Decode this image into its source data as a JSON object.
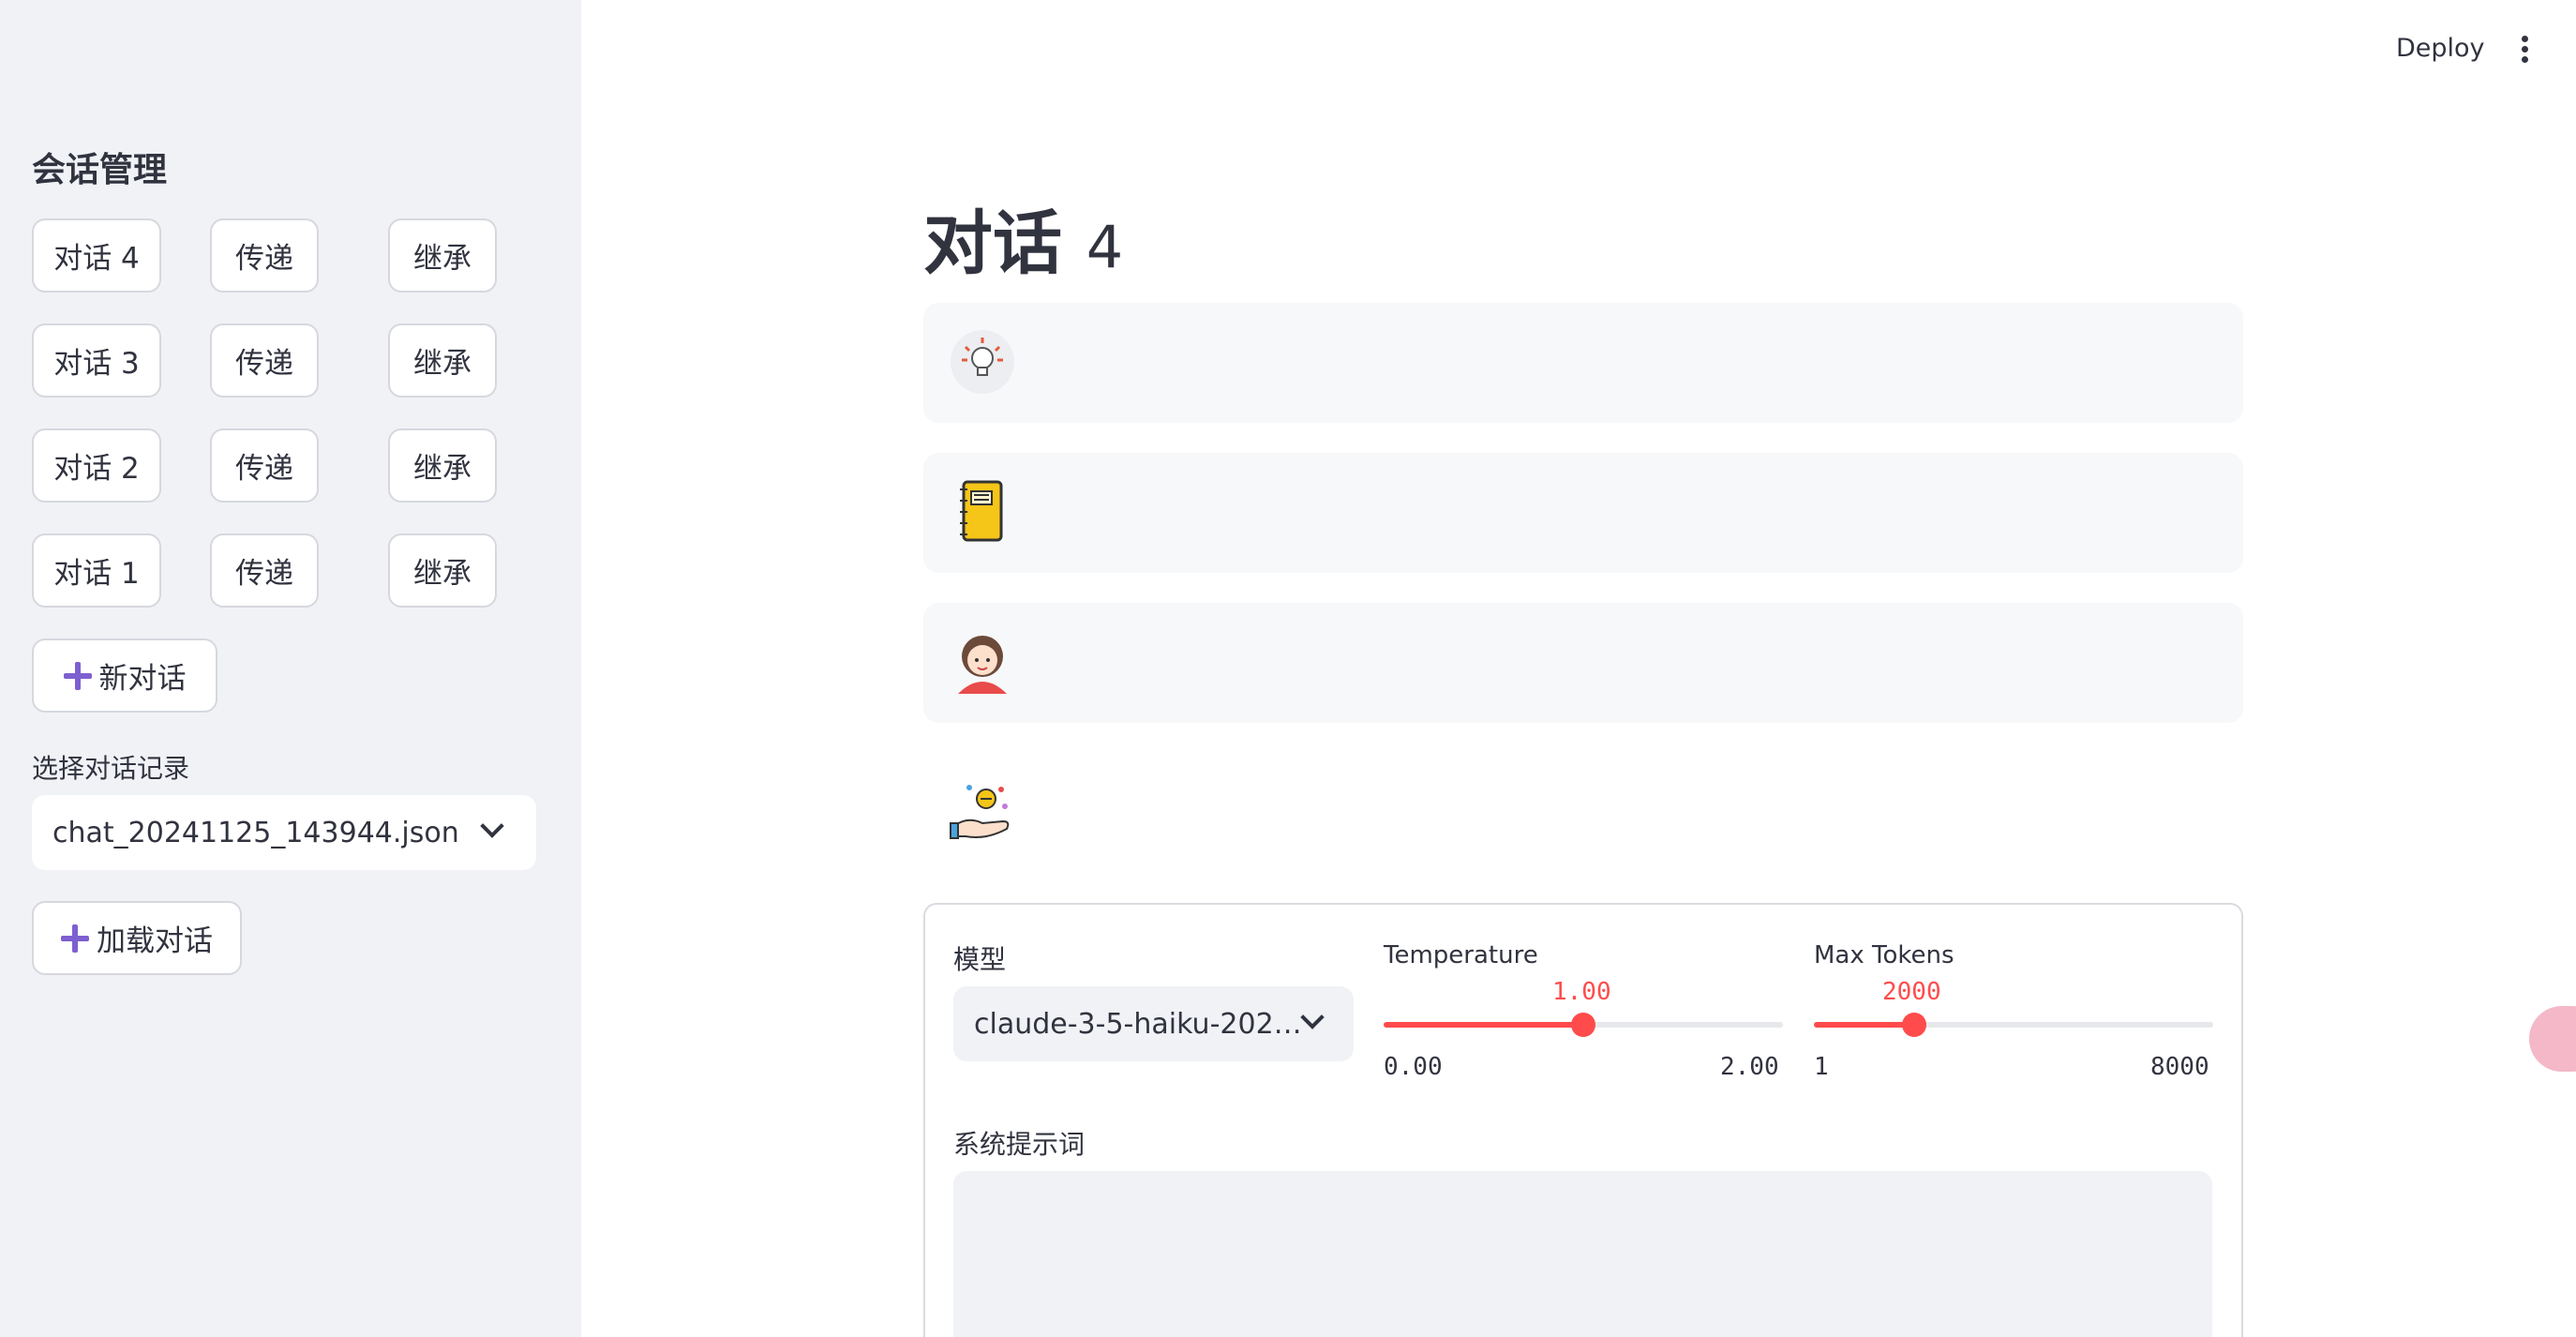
{
  "topbar": {
    "deploy_label": "Deploy"
  },
  "sidebar": {
    "heading": "会话管理",
    "conversations": [
      {
        "label": "对话 4",
        "pass": "传递",
        "inherit": "继承"
      },
      {
        "label": "对话 3",
        "pass": "传递",
        "inherit": "继承"
      },
      {
        "label": "对话 2",
        "pass": "传递",
        "inherit": "继承"
      },
      {
        "label": "对话 1",
        "pass": "传递",
        "inherit": "继承"
      }
    ],
    "new_conversation_label": "新对话",
    "history_label": "选择对话记录",
    "history_selected": "chat_20241125_143944.json",
    "load_label": "加载对话"
  },
  "main": {
    "title_text": "对话",
    "title_num": "4",
    "messages": [
      {
        "icon": "lightbulb-icon"
      },
      {
        "icon": "notebook-icon"
      },
      {
        "icon": "girl-avatar-icon"
      },
      {
        "icon": "hand-coins-icon"
      }
    ],
    "settings": {
      "model_label": "模型",
      "model_value": "claude-3-5-haiku-202…",
      "temperature": {
        "label": "Temperature",
        "value": "1.00",
        "min": "0.00",
        "max": "2.00",
        "fraction": 0.5
      },
      "max_tokens": {
        "label": "Max Tokens",
        "value": "2000",
        "min": "1",
        "max": "8000",
        "fraction": 0.25
      },
      "system_prompt_label": "系统提示词"
    }
  },
  "colors": {
    "accent": "#ff4b4b",
    "plus_icon": "#7d5fd0",
    "sidebar_bg": "#f0f2f6"
  }
}
